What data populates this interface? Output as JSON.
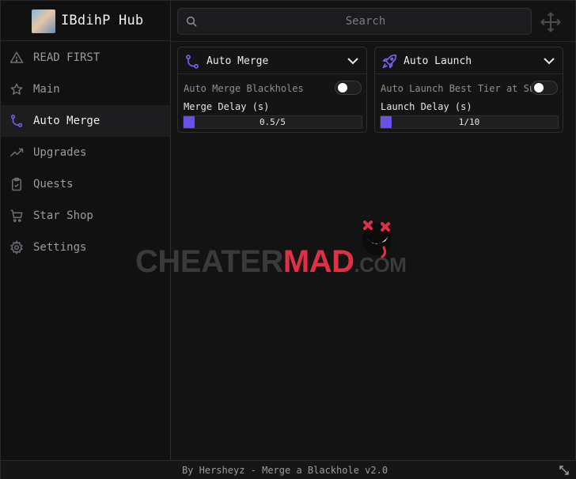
{
  "app": {
    "title": "IBdihP Hub"
  },
  "search": {
    "placeholder": "Search"
  },
  "sidebar": {
    "items": [
      {
        "label": "READ FIRST",
        "icon": "warning-icon"
      },
      {
        "label": "Main",
        "icon": "star-icon"
      },
      {
        "label": "Auto Merge",
        "icon": "merge-icon",
        "active": true
      },
      {
        "label": "Upgrades",
        "icon": "trend-up-icon"
      },
      {
        "label": "Quests",
        "icon": "clipboard-check-icon"
      },
      {
        "label": "Star Shop",
        "icon": "cart-icon"
      },
      {
        "label": "Settings",
        "icon": "gear-icon"
      }
    ]
  },
  "cards": {
    "auto_merge": {
      "title": "Auto Merge",
      "toggle_label": "Auto Merge Blackholes",
      "toggle_on": false,
      "slider_label": "Merge Delay (s)",
      "slider_value": "0.5/5",
      "slider_fraction": 0.1
    },
    "auto_launch": {
      "title": "Auto Launch",
      "toggle_label": "Auto Launch Best Tier at Sun",
      "toggle_on": false,
      "slider_label": "Launch Delay (s)",
      "slider_value": "1/10",
      "slider_fraction": 0.1
    }
  },
  "watermark": {
    "part1": "CHEATER",
    "part2": "MAD",
    "part3": ".COM"
  },
  "footer": {
    "text": "By Hersheyz - Merge a Blackhole v2.0"
  },
  "colors": {
    "accent": "#6950ea",
    "watermark_red": "#e03048"
  }
}
